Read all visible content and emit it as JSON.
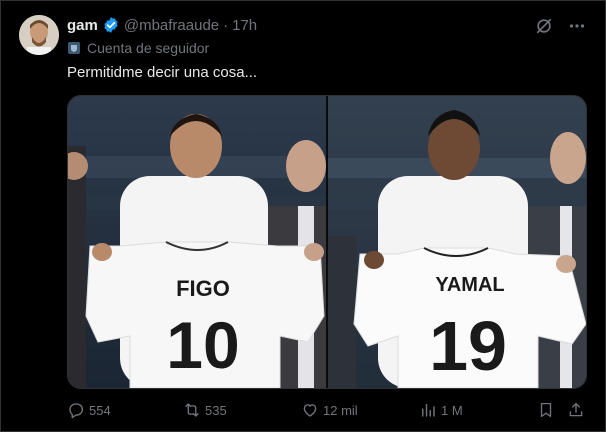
{
  "tweet": {
    "author_name": "gam",
    "handle": "@mbafraaude",
    "separator": "·",
    "time": "17h",
    "account_label": "Cuenta de seguidor",
    "text": "Permitidme decir una cosa..."
  },
  "media": {
    "left_jersey_name": "FIGO",
    "left_jersey_number": "10",
    "right_jersey_name": "YAMAL",
    "right_jersey_number": "19"
  },
  "actions": {
    "replies": "554",
    "reposts": "535",
    "likes": "12 mil",
    "views": "1 M"
  },
  "colors": {
    "verified": "#1d9bf0",
    "text": "#e7e9ea",
    "muted": "#71767b",
    "background": "#000000"
  },
  "icons": [
    "grok-icon",
    "more-icon",
    "verified-badge-icon",
    "shield-icon",
    "reply-icon",
    "repost-icon",
    "like-icon",
    "views-icon",
    "bookmark-icon",
    "share-icon"
  ]
}
